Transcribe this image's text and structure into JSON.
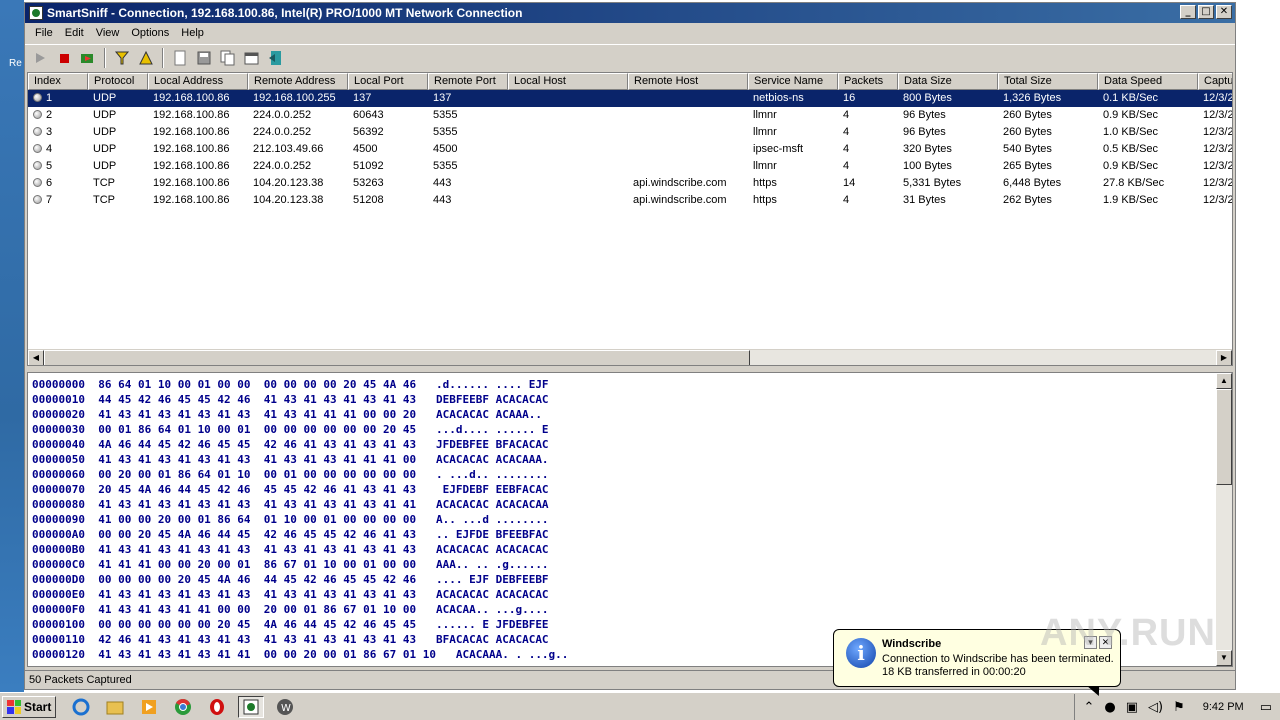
{
  "window": {
    "app": "SmartSniff",
    "title": "SmartSniff  -  Connection, 192.168.100.86, Intel(R) PRO/1000 MT Network Connection",
    "minimize": "_",
    "maximize": "□",
    "close": "✕"
  },
  "menu": [
    "File",
    "Edit",
    "View",
    "Options",
    "Help"
  ],
  "toolbar_icons": [
    "play-icon",
    "stop-icon",
    "go-icon",
    "filter-icon",
    "filter-options-icon",
    "new-icon",
    "save-icon",
    "copy-icon",
    "properties-icon",
    "exit-icon"
  ],
  "columns": [
    "Index",
    "Protocol",
    "Local Address",
    "Remote Address",
    "Local Port",
    "Remote Port",
    "Local Host",
    "Remote Host",
    "Service Name",
    "Packets",
    "Data Size",
    "Total Size",
    "Data Speed",
    "Captu"
  ],
  "rows": [
    {
      "index": "1",
      "protocol": "UDP",
      "local_address": "192.168.100.86",
      "remote_address": "192.168.100.255",
      "local_port": "137",
      "remote_port": "137",
      "local_host": "",
      "remote_host": "",
      "service": "netbios-ns",
      "packets": "16",
      "data_size": "800 Bytes",
      "total_size": "1,326 Bytes",
      "speed": "0.1 KB/Sec",
      "capture": "12/3/2"
    },
    {
      "index": "2",
      "protocol": "UDP",
      "local_address": "192.168.100.86",
      "remote_address": "224.0.0.252",
      "local_port": "60643",
      "remote_port": "5355",
      "local_host": "",
      "remote_host": "",
      "service": "llmnr",
      "packets": "4",
      "data_size": "96 Bytes",
      "total_size": "260 Bytes",
      "speed": "0.9 KB/Sec",
      "capture": "12/3/2"
    },
    {
      "index": "3",
      "protocol": "UDP",
      "local_address": "192.168.100.86",
      "remote_address": "224.0.0.252",
      "local_port": "56392",
      "remote_port": "5355",
      "local_host": "",
      "remote_host": "",
      "service": "llmnr",
      "packets": "4",
      "data_size": "96 Bytes",
      "total_size": "260 Bytes",
      "speed": "1.0 KB/Sec",
      "capture": "12/3/2"
    },
    {
      "index": "4",
      "protocol": "UDP",
      "local_address": "192.168.100.86",
      "remote_address": "212.103.49.66",
      "local_port": "4500",
      "remote_port": "4500",
      "local_host": "",
      "remote_host": "",
      "service": "ipsec-msft",
      "packets": "4",
      "data_size": "320 Bytes",
      "total_size": "540 Bytes",
      "speed": "0.5 KB/Sec",
      "capture": "12/3/2"
    },
    {
      "index": "5",
      "protocol": "UDP",
      "local_address": "192.168.100.86",
      "remote_address": "224.0.0.252",
      "local_port": "51092",
      "remote_port": "5355",
      "local_host": "",
      "remote_host": "",
      "service": "llmnr",
      "packets": "4",
      "data_size": "100 Bytes",
      "total_size": "265 Bytes",
      "speed": "0.9 KB/Sec",
      "capture": "12/3/2"
    },
    {
      "index": "6",
      "protocol": "TCP",
      "local_address": "192.168.100.86",
      "remote_address": "104.20.123.38",
      "local_port": "53263",
      "remote_port": "443",
      "local_host": "",
      "remote_host": "api.windscribe.com",
      "service": "https",
      "packets": "14",
      "data_size": "5,331 Bytes",
      "total_size": "6,448 Bytes",
      "speed": "27.8 KB/Sec",
      "capture": "12/3/2"
    },
    {
      "index": "7",
      "protocol": "TCP",
      "local_address": "192.168.100.86",
      "remote_address": "104.20.123.38",
      "local_port": "51208",
      "remote_port": "443",
      "local_host": "",
      "remote_host": "api.windscribe.com",
      "service": "https",
      "packets": "4",
      "data_size": "31 Bytes",
      "total_size": "262 Bytes",
      "speed": "1.9 KB/Sec",
      "capture": "12/3/2"
    }
  ],
  "hex": [
    "00000000  86 64 01 10 00 01 00 00  00 00 00 00 20 45 4A 46   .d...... .... EJF",
    "00000010  44 45 42 46 45 45 42 46  41 43 41 43 41 43 41 43   DEBFEEBF ACACACAC",
    "00000020  41 43 41 43 41 43 41 43  41 43 41 41 41 00 00 20   ACACACAC ACAAA.. ",
    "00000030  00 01 86 64 01 10 00 01  00 00 00 00 00 00 20 45   ...d.... ...... E",
    "00000040  4A 46 44 45 42 46 45 45  42 46 41 43 41 43 41 43   JFDEBFEE BFACACAC",
    "00000050  41 43 41 43 41 43 41 43  41 43 41 43 41 41 41 00   ACACACAC ACACAAA.",
    "00000060  00 20 00 01 86 64 01 10  00 01 00 00 00 00 00 00   . ...d.. ........",
    "00000070  20 45 4A 46 44 45 42 46  45 45 42 46 41 43 41 43    EJFDEBF EEBFACAC",
    "00000080  41 43 41 43 41 43 41 43  41 43 41 43 41 43 41 41   ACACACAC ACACACAA",
    "00000090  41 00 00 20 00 01 86 64  01 10 00 01 00 00 00 00   A.. ...d ........",
    "000000A0  00 00 20 45 4A 46 44 45  42 46 45 45 42 46 41 43   .. EJFDE BFEEBFAC",
    "000000B0  41 43 41 43 41 43 41 43  41 43 41 43 41 43 41 43   ACACACAC ACACACAC",
    "000000C0  41 41 41 00 00 20 00 01  86 67 01 10 00 01 00 00   AAA.. .. .g......",
    "000000D0  00 00 00 00 20 45 4A 46  44 45 42 46 45 45 42 46   .... EJF DEBFEEBF",
    "000000E0  41 43 41 43 41 43 41 43  41 43 41 43 41 43 41 43   ACACACAC ACACACAC",
    "000000F0  41 43 41 43 41 41 00 00  20 00 01 86 67 01 10 00   ACACAA.. ...g....",
    "00000100  00 00 00 00 00 00 20 45  4A 46 44 45 42 46 45 45   ...... E JFDEBFEE",
    "00000110  42 46 41 43 41 43 41 43  41 43 41 43 41 43 41 43   BFACACAC ACACACAC",
    "00000120  41 43 41 43 41 43 41 41  00 00 20 00 01 86 67 01 10   ACACAAA. . ...g.."
  ],
  "status": "50 Packets Captured",
  "balloon": {
    "title": "Windscribe",
    "line1": "Connection to Windscribe has been terminated.",
    "line2": "18 KB transferred in 00:00:20"
  },
  "taskbar": {
    "start": "Start",
    "clock": "9:42 PM",
    "apps": [
      "ie-icon",
      "explorer-icon",
      "media-player-icon",
      "chrome-icon",
      "opera-icon",
      "smartsniff-icon",
      "windscribe-icon"
    ]
  },
  "watermark": "ANY.RUN",
  "desktop_fragments": [
    "Re"
  ]
}
